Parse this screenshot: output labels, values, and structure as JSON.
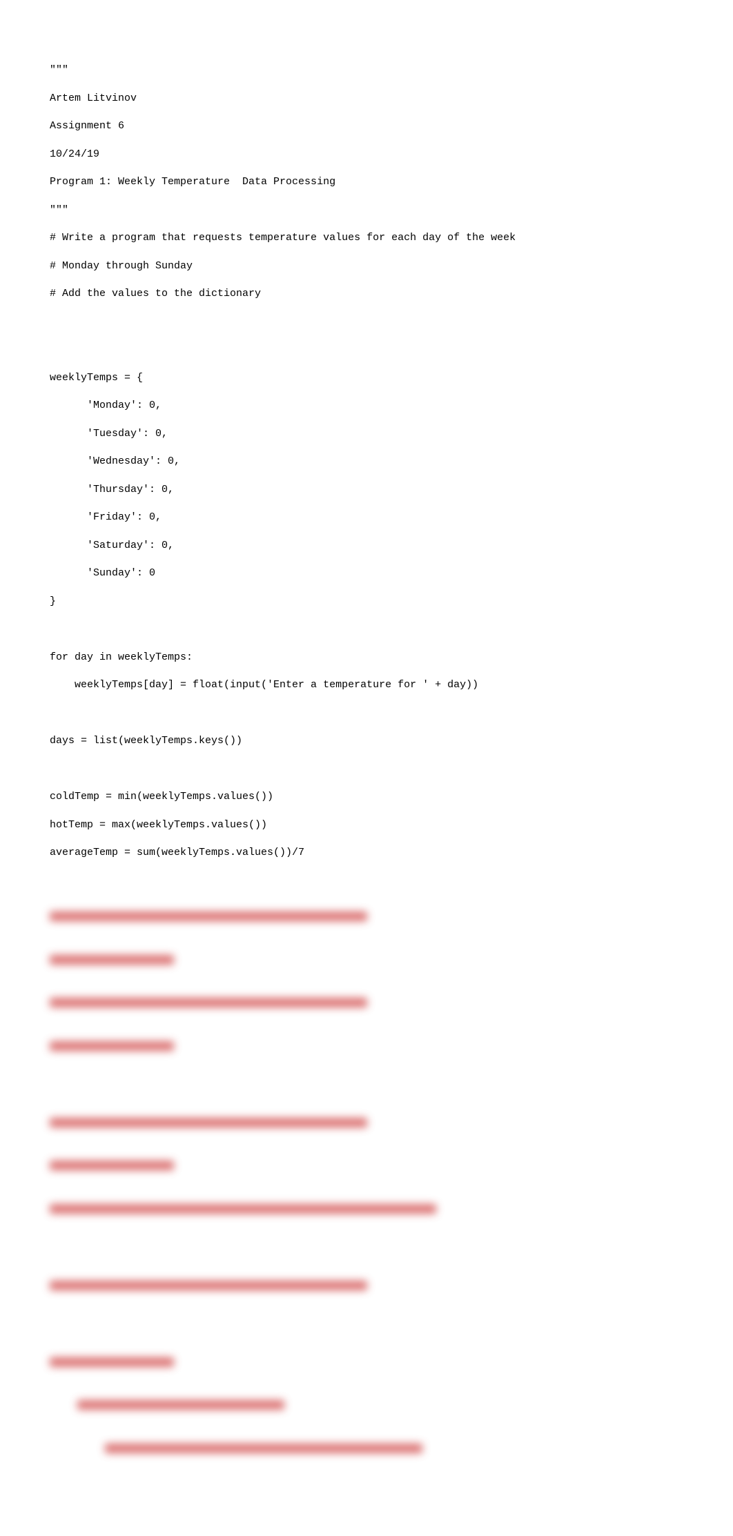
{
  "code": {
    "l1": "\"\"\"",
    "l2": "Artem Litvinov",
    "l3": "Assignment 6",
    "l4": "10/24/19",
    "l5": "Program 1: Weekly Temperature  Data Processing",
    "l6": "\"\"\"",
    "l7": "# Write a program that requests temperature values for each day of the week",
    "l8": "# Monday through Sunday",
    "l9": "# Add the values to the dictionary",
    "l10": "",
    "l11": "",
    "l12": "weeklyTemps = {",
    "l13": "      'Monday': 0,",
    "l14": "      'Tuesday': 0,",
    "l15": "      'Wednesday': 0,",
    "l16": "      'Thursday': 0,",
    "l17": "      'Friday': 0,",
    "l18": "      'Saturday': 0,",
    "l19": "      'Sunday': 0",
    "l20": "}",
    "l21": "",
    "l22": "for day in weeklyTemps:",
    "l23": "    weeklyTemps[day] = float(input('Enter a temperature for ' + day))",
    "l24": "",
    "l25": "days = list(weeklyTemps.keys())",
    "l26": "",
    "l27": "coldTemp = min(weeklyTemps.values())",
    "l28": "hotTemp = max(weeklyTemps.values())",
    "l29": "averageTemp = sum(weeklyTemps.values())/7"
  }
}
